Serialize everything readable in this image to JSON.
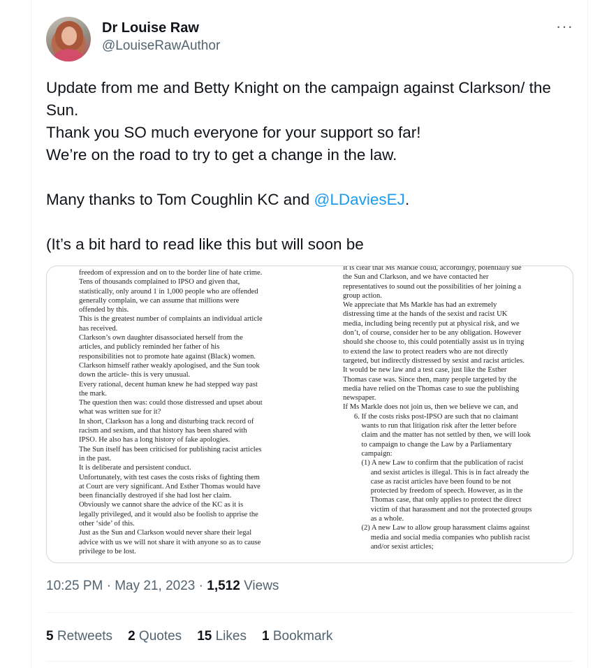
{
  "author": {
    "name": "Dr Louise Raw",
    "handle": "@LouiseRawAuthor"
  },
  "more_label": "···",
  "tweet": {
    "line1": "Update from me and Betty Knight on the campaign against Clarkson/ the Sun.",
    "line2": "Thank you SO much everyone for your support so far!",
    "line3": "We’re on the road to try to get a change in the law.",
    "line4_prefix": "Many thanks to Tom Coughlin KC and ",
    "line4_mention": "@LDaviesEJ",
    "line4_suffix": ".",
    "line5": "(It’s a bit hard to read like this but will soon be"
  },
  "document": {
    "left_lines": [
      "freedom of expression and on to the border line of hate crime.",
      "Tens of thousands complained to IPSO and given that,",
      "statistically, only around 1 in 1,000 people who are offended",
      "generally complain, we can assume that millions were",
      "offended by this.",
      "This is the greatest number of complaints an individual article",
      "has received.",
      "Clarkson’s own daughter disassociated herself from the",
      "articles, and publicly reminded her father of his",
      "responsibilities not to promote hate against (Black) women.",
      "Clarkson himself rather weakly apologised, and the Sun took",
      "down the article- this is very unusual.",
      "Every rational, decent human knew he had stepped way past",
      "the mark.",
      "The question then was: could those distressed and upset about",
      "what was written sue for it?",
      "In short, Clarkson has a long and disturbing track record of",
      "racism and sexism, and that history has been shared with",
      "IPSO. He also has a long history of fake apologies.",
      "The Sun itself has been criticised for publishing racist articles",
      "in the past.",
      "It is deliberate and persistent conduct.",
      "Unfortunately, with test cases the costs risks of fighting them",
      "at Court are very significant. And Esther Thomas would have",
      "been financially destroyed if she had lost her claim.",
      "Obviously we cannot share the advice of the KC as it is",
      "legally privileged, and it would also be foolish to apprise the",
      "other ‘side’ of this.",
      "Just as the Sun and Clarkson would never share their legal",
      "advice with us we will not share it with anyone so as to cause",
      "privilege to be lost."
    ],
    "right_lines": [
      "It is clear that Ms Markle could, accordingly, potentially sue",
      "the Sun and Clarkson, and we have contacted her",
      "representatives to sound out the possibilities of her joining a",
      "group action.",
      "We appreciate that Ms Markle has had an extremely",
      "distressing time at the hands of the sexist and racist UK",
      "media, including being recently put at physical risk, and we",
      "don’t, of course, consider her to be any obligation. However",
      "should she choose to, this could potentially assist us in trying",
      "to extend the law to protect readers who are not directly",
      "targeted, but indirectly distressed by sexist and racist articles.",
      "It would be new law and a test case, just like the Esther",
      "Thomas case was. Since then, many people targeted by the",
      "media have relied on the Thomas case to sue the publishing",
      "newspaper.",
      "If Ms Markle does not join us, then we believe we can, and",
      "      6. If the costs risks post-IPSO are such that no claimant",
      "          wants to run that litigation risk after the letter before",
      "          claim and the matter has not settled by then, we will look",
      "          to campaign to change the Law by a Parliamentary",
      "          campaign:",
      "          (1) A new Law to confirm that the publication of racist",
      "               and sexist articles is illegal. This is in fact already the",
      "               case as racist articles have been found to be not",
      "               protected by freedom of speech. However, as in the",
      "               Thomas case, that only applies to protect the direct",
      "               victim of that harassment and not the protected groups",
      "               as a whole.",
      "          (2) A new Law to allow group harassment claims against",
      "               media and social media companies who publish racist",
      "               and/or sexist articles;"
    ]
  },
  "meta": {
    "time": "10:25 PM",
    "sep1": " · ",
    "date": "May 21, 2023",
    "sep2": " · ",
    "views_count": "1,512",
    "views_label": " Views"
  },
  "stats": {
    "retweets_count": "5",
    "retweets_label": " Retweets",
    "quotes_count": "2",
    "quotes_label": " Quotes",
    "likes_count": "15",
    "likes_label": " Likes",
    "bookmarks_count": "1",
    "bookmarks_label": " Bookmark"
  }
}
